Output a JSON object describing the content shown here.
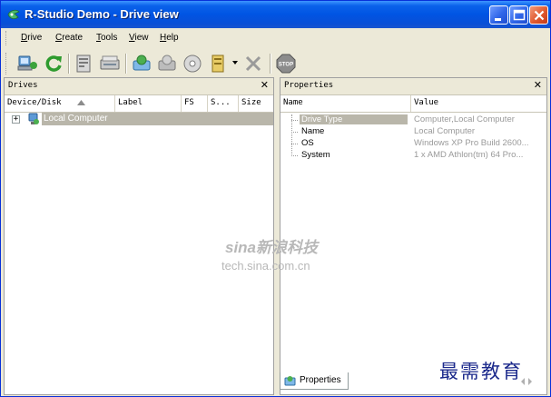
{
  "window": {
    "title": "R-Studio Demo - Drive view"
  },
  "menu": [
    {
      "label": "Drive",
      "underline": "D"
    },
    {
      "label": "Create",
      "underline": "C"
    },
    {
      "label": "Tools",
      "underline": "T"
    },
    {
      "label": "View",
      "underline": "V"
    },
    {
      "label": "Help",
      "underline": "H"
    }
  ],
  "toolbar": {
    "icons": [
      "connect-computer-icon",
      "refresh-icon",
      "drive-info-icon",
      "scan-icon",
      "recover-icon",
      "recover-marked-icon",
      "open-drive-files-icon",
      "create-image-icon",
      "remove-icon",
      "stop-icon"
    ]
  },
  "drives_pane": {
    "title": "Drives",
    "columns": [
      "Device/Disk",
      "Label",
      "FS",
      "S...",
      "Size"
    ],
    "sort_column": "Device/Disk",
    "rows": [
      {
        "name": "Local Computer",
        "expand": "+"
      }
    ]
  },
  "properties_pane": {
    "title": "Properties",
    "columns": [
      "Name",
      "Value"
    ],
    "rows": [
      {
        "name": "Drive Type",
        "value": "Computer,Local Computer"
      },
      {
        "name": "Name",
        "value": "Local Computer"
      },
      {
        "name": "OS",
        "value": "Windows XP Pro Build 2600..."
      },
      {
        "name": "System",
        "value": "1 x AMD Athlon(tm) 64 Pro..."
      }
    ],
    "bottom_tab": "Properties"
  },
  "colors": {
    "titlebar": "#0054e3",
    "selection": "#b9b6aa",
    "window_bg": "#ece9d8"
  },
  "watermarks": {
    "sina_logo": "sina新浪科技",
    "sina_url": "tech.sina.com.cn",
    "xuexi": "最需教育"
  }
}
